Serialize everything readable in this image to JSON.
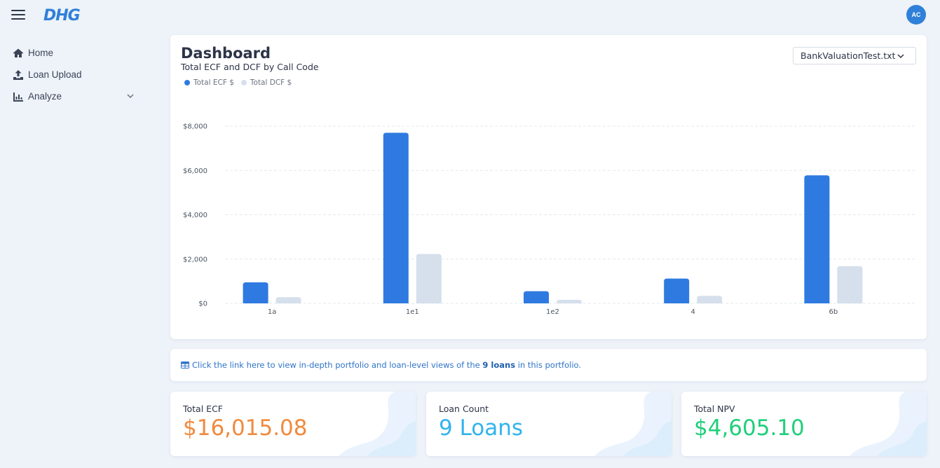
{
  "header": {
    "logo": "DHG",
    "avatar_initials": "AC"
  },
  "sidebar": {
    "items": [
      {
        "label": "Home",
        "icon": "home-icon"
      },
      {
        "label": "Loan Upload",
        "icon": "upload-icon"
      },
      {
        "label": "Analyze",
        "icon": "bar-chart-icon",
        "expandable": true
      }
    ]
  },
  "dashboard": {
    "title": "Dashboard",
    "file_select": "BankValuationTest.txt"
  },
  "chart_data": {
    "type": "bar",
    "title": "Total ECF and DCF by Call Code",
    "categories": [
      "1a",
      "1e1",
      "1e2",
      "4",
      "6b"
    ],
    "series": [
      {
        "name": "Total ECF $",
        "color": "#2f7ae0",
        "values": [
          950,
          7700,
          550,
          1120,
          5780
        ]
      },
      {
        "name": "Total DCF $",
        "color": "#d6e0ec",
        "values": [
          280,
          2230,
          160,
          340,
          1680
        ]
      }
    ],
    "ylim": [
      0,
      8000
    ],
    "yticks": [
      0,
      2000,
      4000,
      6000,
      8000
    ],
    "ytick_labels": [
      "$0",
      "$2,000",
      "$4,000",
      "$6,000",
      "$8,000"
    ],
    "legend": "top-left",
    "grid": true
  },
  "info": {
    "prefix": "Click the link here to view in-depth portfolio and loan-level views of the",
    "highlight": "9 loans",
    "suffix": "in this portfolio."
  },
  "stats": [
    {
      "label": "Total ECF",
      "value": "$16,015.08",
      "color": "#f08a3e"
    },
    {
      "label": "Loan Count",
      "value": "9 Loans",
      "color": "#31b3ee"
    },
    {
      "label": "Total NPV",
      "value": "$4,605.10",
      "color": "#1fcf7a"
    }
  ]
}
